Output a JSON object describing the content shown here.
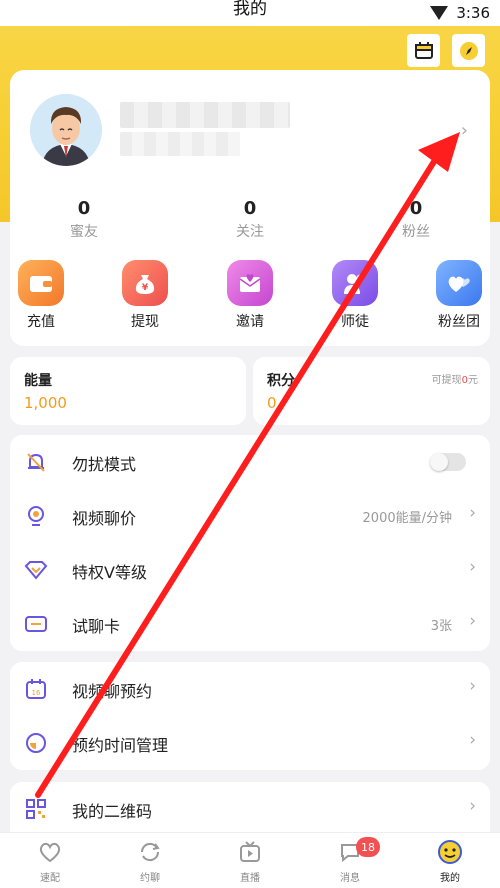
{
  "status_bar": {
    "title": "我的",
    "time": "3:36"
  },
  "profile": {
    "stats": [
      {
        "value": "0",
        "label": "蜜友"
      },
      {
        "value": "0",
        "label": "关注"
      },
      {
        "value": "0",
        "label": "粉丝"
      }
    ]
  },
  "actions": [
    {
      "label": "充值",
      "icon": "wallet-icon",
      "color": "#f7923a"
    },
    {
      "label": "提现",
      "icon": "money-bag-icon",
      "color": "#f26b5b"
    },
    {
      "label": "邀请",
      "icon": "mail-heart-icon",
      "color": "#d75ed6"
    },
    {
      "label": "师徒",
      "icon": "users-icon",
      "color": "#8a5cf0"
    },
    {
      "label": "粉丝团",
      "icon": "hearts-icon",
      "color": "#4f8ef7"
    }
  ],
  "energy": {
    "label": "能量",
    "value": "1,000"
  },
  "points": {
    "label": "积分",
    "value": "0",
    "note_prefix": "可提现",
    "note_value": "0",
    "note_suffix": "元"
  },
  "menu_group_1": [
    {
      "label": "勿扰模式",
      "icon": "bell-off-icon",
      "value": ""
    },
    {
      "label": "视频聊价",
      "icon": "camera-icon",
      "value": "2000能量/分钟"
    },
    {
      "label": "特权V等级",
      "icon": "diamond-icon",
      "value": ""
    },
    {
      "label": "试聊卡",
      "icon": "ticket-icon",
      "value": "3张"
    }
  ],
  "menu_group_2": [
    {
      "label": "视频聊预约",
      "icon": "calendar-icon",
      "value": ""
    },
    {
      "label": "预约时间管理",
      "icon": "clock-icon",
      "value": ""
    }
  ],
  "menu_group_3": [
    {
      "label": "我的二维码",
      "icon": "qrcode-icon",
      "value": ""
    }
  ],
  "tabbar": [
    {
      "label": "速配",
      "icon": "heart-icon"
    },
    {
      "label": "约聊",
      "icon": "refresh-icon"
    },
    {
      "label": "直播",
      "icon": "tv-icon"
    },
    {
      "label": "消息",
      "icon": "chat-icon",
      "badge": "18"
    },
    {
      "label": "我的",
      "icon": "profile-icon",
      "active": true
    }
  ],
  "colors": {
    "brand_yellow": "#f7cf33",
    "energy_orange": "#f59b1b",
    "annotation_red": "#ff1e1e"
  }
}
